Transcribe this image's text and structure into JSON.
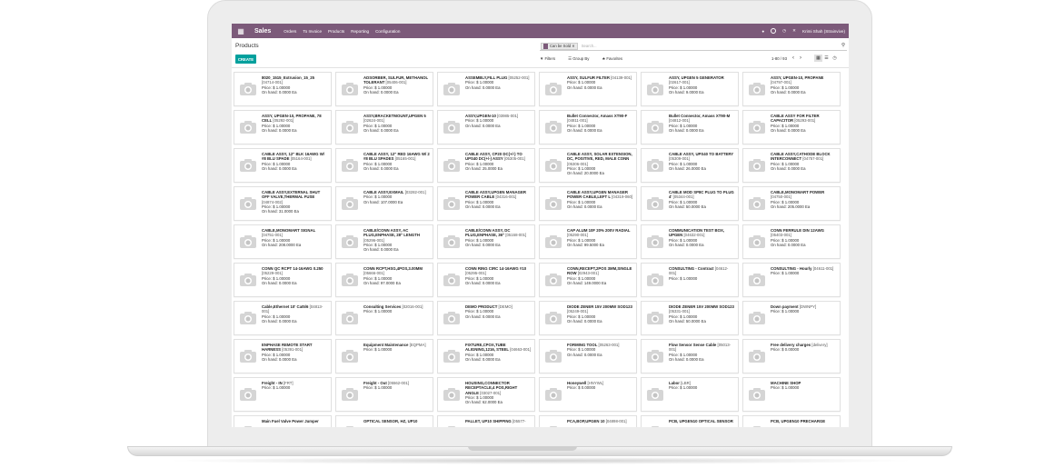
{
  "navbar": {
    "apps_icon": "apps-grid-icon",
    "brand": "Sales",
    "menu": [
      "Orders",
      "To Invoice",
      "Products",
      "Reporting",
      "Configuration"
    ],
    "user": "Krimi Shah (Strainvive)"
  },
  "control_panel": {
    "title": "Products",
    "create_label": "CREATE",
    "facet": "Can be Sold",
    "search_placeholder": "Search...",
    "filters_label": "Filters",
    "group_by_label": "Group By",
    "favorites_label": "Favorites",
    "pager": "1-80 / 93"
  },
  "products": [
    {
      "name": "8020_1515_Extrusion_15_25",
      "code": "[04714-001]",
      "price": "Price: $ 1.00000",
      "onhand": "On hand: 0.0000 Ea"
    },
    {
      "name": "ADSORBER, SULFUR, METHANOL TOLERANT",
      "code": "[05406-001]",
      "price": "Price: $ 1.00000",
      "onhand": "On hand: 0.0000 Ea"
    },
    {
      "name": "ASSEMBLY,FILL PLUG",
      "code": "[05252-001]",
      "price": "Price: $ 1.00000",
      "onhand": "On hand: 0.0000 Ea"
    },
    {
      "name": "ASSY, SULFUR FILTER",
      "code": "[04139-001]",
      "price": "Price: $ 1.00000",
      "onhand": "On hand: 0.0000 Ea"
    },
    {
      "name": "ASSY, UPGEN 5 GENERATOR",
      "code": "[02617-001]",
      "price": "Price: $ 1.00000",
      "onhand": "On hand: 9.0000 Ea"
    },
    {
      "name": "ASSY, UPGEN-10, PROPANE",
      "code": "[04797-001]",
      "price": "Price: $ 1.00000",
      "onhand": "On hand: 0.0000 Ea"
    },
    {
      "name": "ASSY, UPGEN-10, PROPANE, 78 CELL",
      "code": "[05292-001]",
      "price": "Price: $ 1.00000",
      "onhand": "On hand: 0.0000 Ea"
    },
    {
      "name": "ASSY,BRACKETMOUNT,UPGEN 5",
      "code": "[02624-001]",
      "price": "Price: $ 1.00000",
      "onhand": "On hand: 0.0000 Ea"
    },
    {
      "name": "ASSY,UPGEN-10",
      "code": "[03985-001]",
      "price": "Price: $ 1.00000",
      "onhand": "On hand: 0.0000 Ea"
    },
    {
      "name": "Bullet Connector, Amass XT90-F",
      "code": "[04811-001]",
      "price": "Price: $ 1.00000",
      "onhand": "On hand: 0.0000 Ea"
    },
    {
      "name": "Bullet Connector, Amass XT90-M",
      "code": "[04812-001]",
      "price": "Price: $ 1.00000",
      "onhand": "On hand: 0.0000 Ea"
    },
    {
      "name": "CABLE ASSY FOR FILTER CAPACITOR",
      "code": "[05293-001]",
      "price": "Price: $ 1.00000",
      "onhand": "On hand: 0.0000 Ea"
    },
    {
      "name": "CABLE ASSY, 12\" BLK 16AWG W/ #8 BLU SPADE",
      "code": "[05164-001]",
      "price": "Price: $ 1.00000",
      "onhand": "On hand: 0.0000 Ea"
    },
    {
      "name": "CABLE ASSY, 12\" RED 16AWG W/ 2 #8 BLU SPADES",
      "code": "[05165-001]",
      "price": "Price: $ 1.00000",
      "onhand": "On hand: 0.0000 Ea"
    },
    {
      "name": "CABLE ASSY, CP20 DC(+/-) TO UPS40 DC(+/-) ASSY",
      "code": "[05305-001]",
      "price": "Price: $ 1.00000",
      "onhand": "On hand: 25.0000 Ea"
    },
    {
      "name": "CABLE ASSY, SOLAR EXTENSION, DC, POSITIVE, RED, MALE CONN",
      "code": "[05306-001]",
      "price": "Price: $ 1.00000",
      "onhand": "On hand: 20.0000 Ea"
    },
    {
      "name": "CABLE ASSY, UPS40 TO BATTERY",
      "code": "[05309-001]",
      "price": "Price: $ 1.00000",
      "onhand": "On hand: 26.0000 Ea"
    },
    {
      "name": "CABLE ASSY,CATHODE BLOCK INTERCONNECT",
      "code": "[04757-001]",
      "price": "Price: $ 1.00000",
      "onhand": "On hand: 0.0000 Ea"
    },
    {
      "name": "CABLE ASSY,EXTERNAL SHUT OFF VALVE,THERMAL FUSE",
      "code": "[04874-002]",
      "price": "Price: $ 1.00000",
      "onhand": "On hand: 31.0000 Ea"
    },
    {
      "name": "CABLE ASSY,EXMAIL",
      "code": "[03282-001]",
      "price": "Price: $ 1.00000",
      "onhand": "On hand: 107.0000 Ea"
    },
    {
      "name": "CABLE ASSY,UPGEN MANAGER POWER CABLE",
      "code": "[04316-001]",
      "price": "Price: $ 1.00000",
      "onhand": "On hand: 0.0000 Ea"
    },
    {
      "name": "CABLE ASSY,UPGEN MANAGER POWER CABLE,LEFT L",
      "code": "[04319-060]",
      "price": "Price: $ 1.00000",
      "onhand": "On hand: 0.0000 Ea"
    },
    {
      "name": "CABLE MOD SP8C PLUG TO PLUG 4'",
      "code": "[05344-001]",
      "price": "Price: $ 1.00000",
      "onhand": "On hand: 50.0000 Ea"
    },
    {
      "name": "CABLE,MONOMART POWER",
      "code": "[04750-001]",
      "price": "Price: $ 1.00000",
      "onhand": "On hand: 205.0000 Ea"
    },
    {
      "name": "CABLE,MONOMART SIGNAL",
      "code": "[04751-001]",
      "price": "Price: $ 1.00000",
      "onhand": "On hand: 208.0000 Ea"
    },
    {
      "name": "CABLE/CONN ASSY, AC PLUG,ENPHASE, 28\" LENGTH",
      "code": "[05296-001]",
      "price": "Price: $ 1.00000",
      "onhand": "On hand: 0.0000 Ea"
    },
    {
      "name": "CABLE/CONN ASSY, DC PLUG,ENPHASE, 36\"",
      "code": "[05168-001]",
      "price": "Price: $ 1.00000",
      "onhand": "On hand: 0.0000 Ea"
    },
    {
      "name": "CAP ALUM 10F 20% 200V RADIAL",
      "code": "[05290-001]",
      "price": "Price: $ 1.00000",
      "onhand": "On hand: 99.5000 Ea"
    },
    {
      "name": "COMMUNICATION TEST BOX, UPGEN",
      "code": "[04632-001]",
      "price": "Price: $ 1.00000",
      "onhand": "On hand: 0.0000 Ea"
    },
    {
      "name": "CONN FERRULE DIN 12AWG",
      "code": "[05403-001]",
      "price": "Price: $ 1.00000",
      "onhand": "On hand: 0.0000 Ea"
    },
    {
      "name": "CONN QC RCPT 14-16AWG 0.250",
      "code": "[05229-001]",
      "price": "Price: $ 1.00000",
      "onhand": "On hand: 0.0000 Ea"
    },
    {
      "name": "CONN RCPT,HSG,4POS,3.00MM",
      "code": "[05666-001]",
      "price": "Price: $ 1.00000",
      "onhand": "On hand: 97.0000 Ea"
    },
    {
      "name": "CONN RING CIRC 14-16AWG #10",
      "code": "[05295-001]",
      "price": "Price: $ 1.00000",
      "onhand": "On hand: 0.0000 Ea"
    },
    {
      "name": "CONN,RECEPT,2POS 3MM,SINGLE ROW",
      "code": "[02943-001]",
      "price": "Price: $ 1.00000",
      "onhand": "On hand: 149.0000 Ea"
    },
    {
      "name": "CONSULTING - Contract",
      "code": "[04612-001]",
      "price": "Price: $ 1.00000",
      "onhand": ""
    },
    {
      "name": "CONSULTING - Hourly",
      "code": "[04611-001]",
      "price": "Price: $ 1.00000",
      "onhand": ""
    },
    {
      "name": "Cable,Ethernet 10' Cat5/6",
      "code": "[04813-001]",
      "price": "Price: $ 1.00000",
      "onhand": "On hand: 0.0000 Ea"
    },
    {
      "name": "Consulting Services",
      "code": "[02016-001]",
      "price": "Price: $ 1.00000",
      "onhand": ""
    },
    {
      "name": "DEMO PRODUCT",
      "code": "[DEMO]",
      "price": "Price: $ 1.00000",
      "onhand": "On hand: 0.0000 Ea"
    },
    {
      "name": "DIODE ZENER 15V 200MW SOD123",
      "code": "[05249-001]",
      "price": "Price: $ 1.00000",
      "onhand": "On hand: 0.0000 Ea"
    },
    {
      "name": "DIODE ZENER 15V 200MW SOD123",
      "code": "[05331-001]",
      "price": "Price: $ 1.00000",
      "onhand": "On hand: 50.0000 Ea"
    },
    {
      "name": "Down payment",
      "code": "[DWNPY]",
      "price": "Price: $ 1.00000",
      "onhand": ""
    },
    {
      "name": "ENPHASE REMOTE START HARNESS",
      "code": "[05391-001]",
      "price": "Price: $ 1.00000",
      "onhand": "On hand: 0.0000 Ea"
    },
    {
      "name": "Equipment Maintenance",
      "code": "[EQPMA]",
      "price": "Price: $ 1.00000",
      "onhand": ""
    },
    {
      "name": "FIXTURE,CPOX,TUBE ALIGNING,1216, STEEL",
      "code": "[04663-001]",
      "price": "Price: $ 1.00000",
      "onhand": "On hand: 0.0000 Ea"
    },
    {
      "name": "FORMING TOOL",
      "code": "[05263-001]",
      "price": "Price: $ 1.00000",
      "onhand": "On hand: 0.0000 Ea"
    },
    {
      "name": "Flow Sensor Sense Cable",
      "code": "[05013-001]",
      "price": "Price: $ 1.00000",
      "onhand": "On hand: 0.0000 Ea"
    },
    {
      "name": "Free delivery charges",
      "code": "[delivery]",
      "price": "Price: $ 0.00000",
      "onhand": ""
    },
    {
      "name": "Freight - IN",
      "code": "[FRT]",
      "price": "Price: $ 1.00000",
      "onhand": ""
    },
    {
      "name": "Freight - Out",
      "code": "[05562-001]",
      "price": "Price: $ 1.00000",
      "onhand": ""
    },
    {
      "name": "HOUSING,CONNECTOR RECEPTACLE,4 POS,RIGHT ANGLE",
      "code": "[03027-001]",
      "price": "Price: $ 1.00000",
      "onhand": "On hand: 62.0000 Ea"
    },
    {
      "name": "Honeywell",
      "code": "[HNYWL]",
      "price": "Price: $ 0.00000",
      "onhand": ""
    },
    {
      "name": "Labor",
      "code": "[LBR]",
      "price": "Price: $ 1.00000",
      "onhand": ""
    },
    {
      "name": "MACHINE SHOP",
      "code": "",
      "price": "Price: $ 1.00000",
      "onhand": ""
    },
    {
      "name": "Main Fuel Valve Power Jumper",
      "code": "",
      "price": "",
      "onhand": ""
    },
    {
      "name": "OPTICAL SENSOR, HZ, UP10",
      "code": "",
      "price": "",
      "onhand": ""
    },
    {
      "name": "PALLET, UP10 SHIPPING",
      "code": "[05577-",
      "price": "",
      "onhand": ""
    },
    {
      "name": "PCA,BOP,UPGEN 10",
      "code": "[04898-001]",
      "price": "",
      "onhand": ""
    },
    {
      "name": "PCB, UPGEN10 OPTICAL SENSOR",
      "code": "",
      "price": "",
      "onhand": ""
    },
    {
      "name": "PCB, UPGEN10 PRECHARGE",
      "code": "",
      "price": "",
      "onhand": ""
    }
  ]
}
